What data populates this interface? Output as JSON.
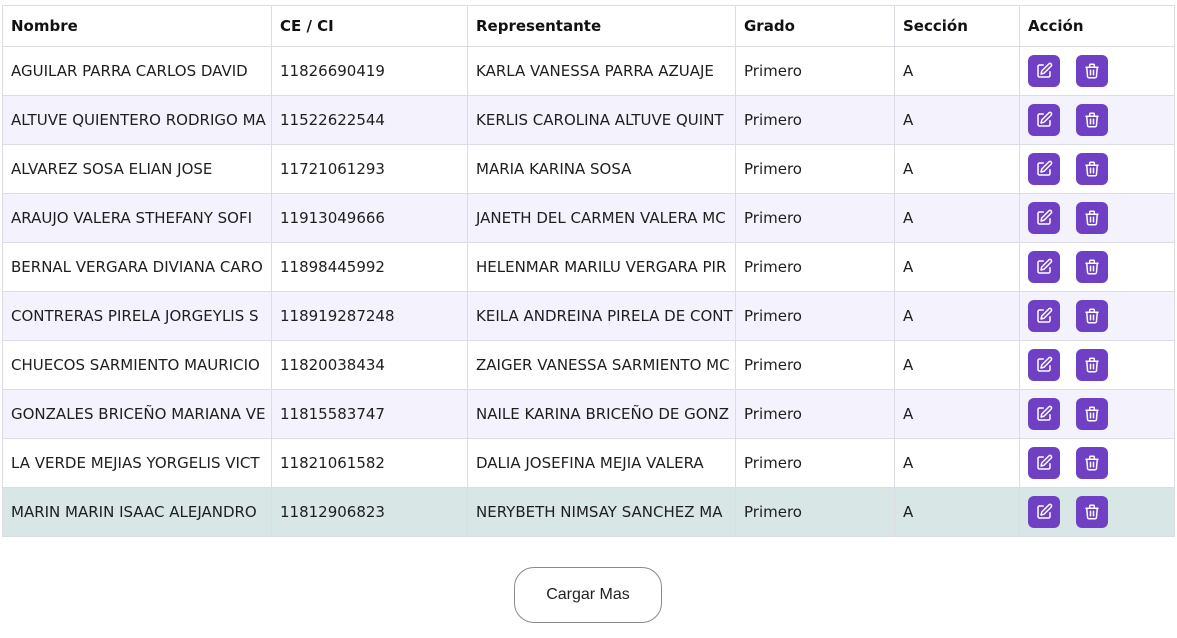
{
  "table": {
    "headers": {
      "name": "Nombre",
      "id": "CE / CI",
      "representative": "Representante",
      "grade": "Grado",
      "section": "Sección",
      "action": "Acción"
    },
    "rows": [
      {
        "name": "AGUILAR PARRA CARLOS DAVID",
        "id": "11826690419",
        "representative": "KARLA VANESSA PARRA AZUAJE",
        "grade": "Primero",
        "section": "A"
      },
      {
        "name": "ALTUVE QUIENTERO RODRIGO MA",
        "id": "11522622544",
        "representative": "KERLIS CAROLINA ALTUVE QUINT",
        "grade": "Primero",
        "section": "A"
      },
      {
        "name": "ALVAREZ SOSA ELIAN JOSE",
        "id": "11721061293",
        "representative": "MARIA KARINA SOSA",
        "grade": "Primero",
        "section": "A"
      },
      {
        "name": "ARAUJO VALERA STHEFANY SOFI",
        "id": "11913049666",
        "representative": "JANETH DEL CARMEN VALERA MC",
        "grade": "Primero",
        "section": "A"
      },
      {
        "name": "BERNAL VERGARA DIVIANA CARO",
        "id": "11898445992",
        "representative": "HELENMAR MARILU VERGARA PIR",
        "grade": "Primero",
        "section": "A"
      },
      {
        "name": "CONTRERAS PIRELA JORGEYLIS S",
        "id": "118919287248",
        "representative": "KEILA ANDREINA PIRELA DE CONT",
        "grade": "Primero",
        "section": "A"
      },
      {
        "name": "CHUECOS SARMIENTO MAURICIO",
        "id": "11820038434",
        "representative": "ZAIGER VANESSA SARMIENTO MC",
        "grade": "Primero",
        "section": "A"
      },
      {
        "name": "GONZALES BRICEÑO MARIANA VE",
        "id": "11815583747",
        "representative": "NAILE KARINA BRICEÑO DE GONZ",
        "grade": "Primero",
        "section": "A"
      },
      {
        "name": "LA VERDE MEJIAS YORGELIS VICT",
        "id": "11821061582",
        "representative": "DALIA JOSEFINA MEJIA VALERA",
        "grade": "Primero",
        "section": "A"
      },
      {
        "name": "MARIN MARIN ISAAC ALEJANDRO",
        "id": "11812906823",
        "representative": "NERYBETH NIMSAY SANCHEZ MA",
        "grade": "Primero",
        "section": "A"
      }
    ],
    "selected_row": 9,
    "action_icons": [
      "edit-icon",
      "trash-icon"
    ]
  },
  "load_more": {
    "label": "Cargar Mas"
  },
  "colors": {
    "accent": "#6f3fc4",
    "row_alt": "#f4f2fc",
    "row_selected": "#d8e6e6",
    "border": "#dcdce4"
  }
}
